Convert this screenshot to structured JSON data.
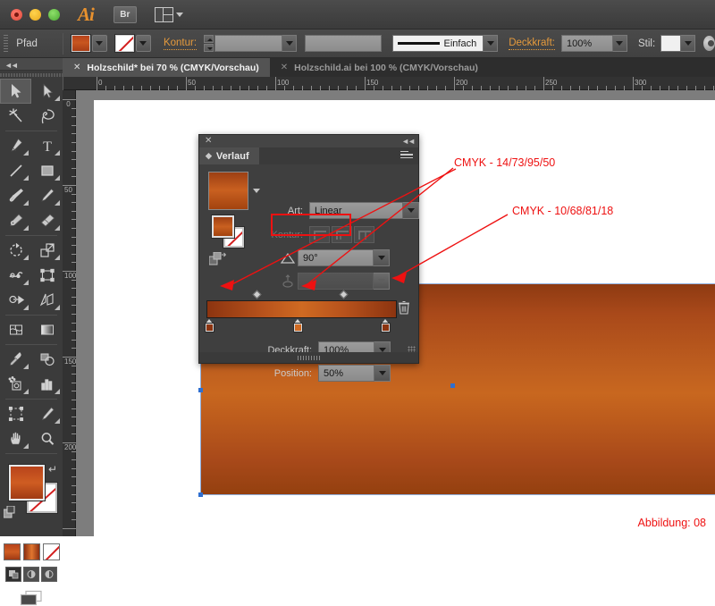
{
  "titlebar": {
    "app_logo": "Ai",
    "bridge_label": "Br",
    "arrange_icon": "arrange-documents-icon",
    "window_buttons": [
      "close",
      "minimize",
      "zoom"
    ]
  },
  "controlbar": {
    "object_label": "Pfad",
    "fill_swatch_name": "fill-color-swatch",
    "stroke_swatch_name": "stroke-none-swatch",
    "stroke_label": "Kontur:",
    "stroke_weight_value": "",
    "stroke_profile_value": "",
    "brush_label": "Einfach",
    "opacity_label": "Deckkraft:",
    "opacity_value": "100%",
    "style_label": "Stil:",
    "style_value": ""
  },
  "tabs": [
    {
      "label": "Holzschild* bei 70 % (CMYK/Vorschau)",
      "active": true
    },
    {
      "label": "Holzschild.ai bei 100 % (CMYK/Vorschau)",
      "active": false
    }
  ],
  "toolbar": {
    "tools": [
      {
        "name": "selection-tool",
        "glyph": "arrow-solid",
        "selected": true,
        "corner": false
      },
      {
        "name": "direct-selection-tool",
        "glyph": "arrow-outline",
        "selected": false,
        "corner": true
      },
      {
        "name": "magic-wand-tool",
        "glyph": "wand",
        "selected": false,
        "corner": false
      },
      {
        "name": "lasso-tool",
        "glyph": "lasso",
        "selected": false,
        "corner": false
      },
      {
        "name": "pen-tool",
        "glyph": "pen",
        "selected": false,
        "corner": true
      },
      {
        "name": "type-tool",
        "glyph": "type",
        "selected": false,
        "corner": true
      },
      {
        "name": "line-segment-tool",
        "glyph": "line",
        "selected": false,
        "corner": true
      },
      {
        "name": "rectangle-tool",
        "glyph": "rectangle",
        "selected": false,
        "corner": true
      },
      {
        "name": "paintbrush-tool",
        "glyph": "brush",
        "selected": false,
        "corner": true
      },
      {
        "name": "pencil-tool",
        "glyph": "pencil",
        "selected": false,
        "corner": true
      },
      {
        "name": "blob-brush-tool",
        "glyph": "blob",
        "selected": false,
        "corner": true
      },
      {
        "name": "eraser-tool",
        "glyph": "eraser",
        "selected": false,
        "corner": true
      },
      {
        "name": "rotate-tool",
        "glyph": "rotate",
        "selected": false,
        "corner": true
      },
      {
        "name": "scale-tool",
        "glyph": "scale",
        "selected": false,
        "corner": true
      },
      {
        "name": "width-tool",
        "glyph": "width",
        "selected": false,
        "corner": true
      },
      {
        "name": "free-transform-tool",
        "glyph": "transform",
        "selected": false,
        "corner": false
      },
      {
        "name": "shape-builder-tool",
        "glyph": "shapebuilder",
        "selected": false,
        "corner": true
      },
      {
        "name": "perspective-grid-tool",
        "glyph": "perspective",
        "selected": false,
        "corner": true
      },
      {
        "name": "mesh-tool",
        "glyph": "mesh",
        "selected": false,
        "corner": false
      },
      {
        "name": "gradient-tool",
        "glyph": "gradient",
        "selected": false,
        "corner": false
      },
      {
        "name": "eyedropper-tool",
        "glyph": "eyedropper",
        "selected": false,
        "corner": true
      },
      {
        "name": "blend-tool",
        "glyph": "blend",
        "selected": false,
        "corner": false
      },
      {
        "name": "symbol-sprayer-tool",
        "glyph": "sprayer",
        "selected": false,
        "corner": true
      },
      {
        "name": "column-graph-tool",
        "glyph": "graph",
        "selected": false,
        "corner": true
      },
      {
        "name": "artboard-tool",
        "glyph": "artboard",
        "selected": false,
        "corner": false
      },
      {
        "name": "slice-tool",
        "glyph": "slice",
        "selected": false,
        "corner": true
      },
      {
        "name": "hand-tool",
        "glyph": "hand",
        "selected": false,
        "corner": true
      },
      {
        "name": "zoom-tool",
        "glyph": "zoom",
        "selected": false,
        "corner": false
      }
    ],
    "fill_stroke": {
      "fill_name": "fill-color-indicator",
      "stroke_name": "stroke-color-indicator",
      "swap_name": "swap-fill-stroke-icon",
      "default_name": "default-fill-stroke-icon"
    },
    "paint_modes": [
      "color-mode",
      "gradient-mode",
      "none-mode"
    ],
    "drawing_modes": [
      "draw-normal",
      "draw-behind",
      "draw-inside"
    ],
    "screen_mode": "change-screen-mode-icon"
  },
  "rulers": {
    "horizontal_labels": [
      "0",
      "50",
      "100",
      "150",
      "200",
      "250",
      "300"
    ],
    "vertical_labels": [
      "0",
      "50",
      "100",
      "150",
      "200"
    ],
    "unit": "mm"
  },
  "panel": {
    "title": "Verlauf",
    "close_icon": "close-icon",
    "collapse_icon": "collapse-panel-icon",
    "menu_icon": "panel-menu-icon",
    "type_label": "Art:",
    "type_value": "Linear",
    "stroke_label": "Kontur:",
    "angle_value": "90°",
    "angle_icon": "gradient-angle-icon",
    "aspect_icon": "gradient-aspect-ratio-icon",
    "aspect_value": "",
    "opacity_label": "Deckkraft:",
    "opacity_value": "100%",
    "position_label": "Position:",
    "position_value": "50%",
    "delete_stop_icon": "delete-gradient-stop-icon",
    "stops": [
      {
        "name": "gradient-stop-left",
        "left_pct": 0,
        "color": "#8c3410"
      },
      {
        "name": "gradient-stop-middle",
        "left_pct": 50,
        "color": "#cf6a22"
      },
      {
        "name": "gradient-stop-right",
        "left_pct": 100,
        "color": "#8c3410"
      }
    ],
    "midpoints": [
      25,
      75
    ]
  },
  "annotations": {
    "note_top": "CMYK - 14/73/95/50",
    "note_bottom": "CMYK - 10/68/81/18",
    "highlight_box": "angle-field-highlight",
    "figure_caption": "Abbildung: 08"
  },
  "colors": {
    "accent_orange": "#e59a3c",
    "annotation_red": "#ee1111",
    "wood_light": "#c8671f",
    "wood_dark": "#8e3a12",
    "selection_blue": "#2f6fd0",
    "panel_bg": "#3f3f3f"
  }
}
